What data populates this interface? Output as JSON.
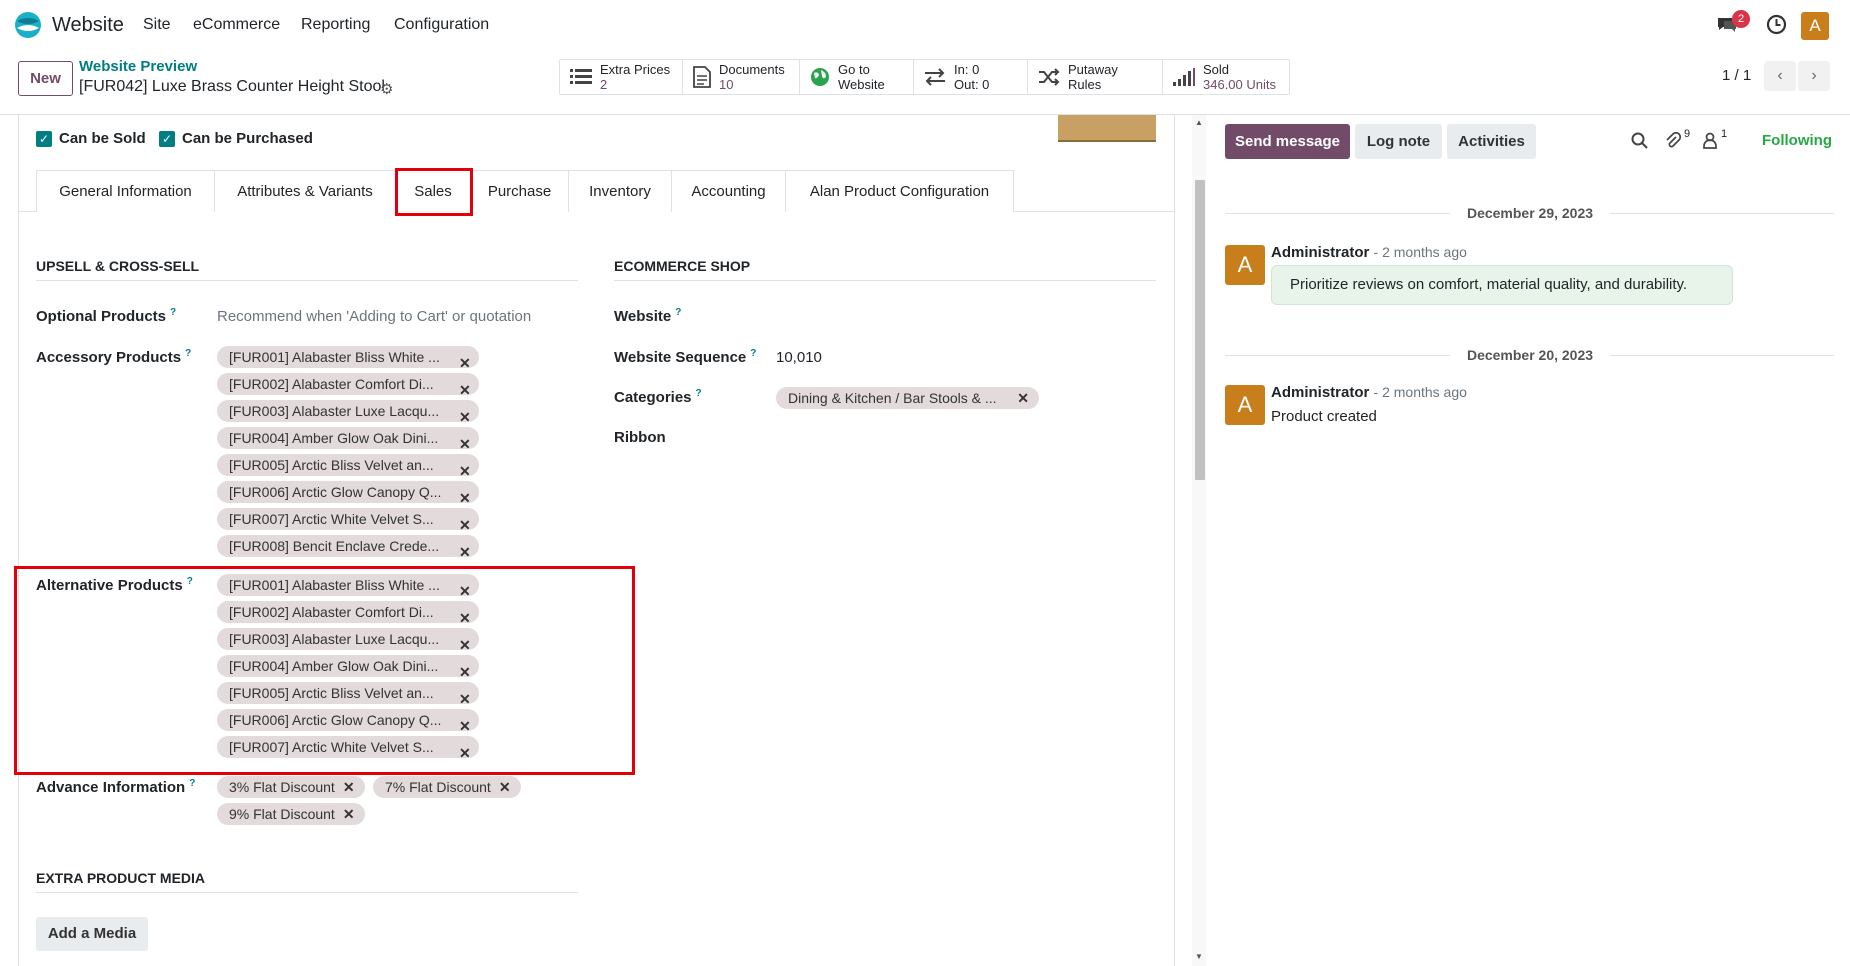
{
  "app": {
    "name": "Website",
    "menu": [
      "Site",
      "eCommerce",
      "Reporting",
      "Configuration"
    ],
    "chat_badge": "2",
    "user_initial": "A"
  },
  "control": {
    "new_label": "New",
    "breadcrumb_parent": "Website Preview",
    "record_title": "[FUR042] Luxe Brass Counter Height Stool",
    "pager": "1 / 1",
    "smart_buttons": [
      {
        "label": "Extra Prices",
        "value": "2",
        "icon": "list-icon"
      },
      {
        "label": "Documents",
        "value": "10",
        "icon": "document-icon"
      },
      {
        "label": "Go to",
        "value": "Website",
        "icon": "globe-icon"
      },
      {
        "label": "In: 0",
        "value": "Out: 0",
        "icon": "transfer-icon"
      },
      {
        "label": "Putaway Rules",
        "value": "",
        "icon": "shuffle-icon"
      },
      {
        "label": "Sold",
        "value": "346.00 Units",
        "icon": "bar-chart-icon"
      }
    ]
  },
  "checkboxes": {
    "can_be_sold": "Can be Sold",
    "can_be_purchased": "Can be Purchased"
  },
  "tabs": [
    "General Information",
    "Attributes & Variants",
    "Sales",
    "Purchase",
    "Inventory",
    "Accounting",
    "Alan Product Configuration"
  ],
  "upsell": {
    "heading": "UPSELL & CROSS-SELL",
    "optional_label": "Optional Products",
    "optional_placeholder": "Recommend when 'Adding to Cart' or quotation",
    "accessory_label": "Accessory Products",
    "accessory_tags": [
      "[FUR001] Alabaster Bliss White ...",
      "[FUR002] Alabaster Comfort Di...",
      "[FUR003] Alabaster Luxe Lacqu...",
      "[FUR004] Amber Glow Oak Dini...",
      "[FUR005] Arctic Bliss Velvet an...",
      "[FUR006] Arctic Glow Canopy Q...",
      "[FUR007] Arctic White Velvet S...",
      "[FUR008] Bencit Enclave Crede..."
    ],
    "alternative_label": "Alternative Products",
    "alternative_tags": [
      "[FUR001] Alabaster Bliss White ...",
      "[FUR002] Alabaster Comfort Di...",
      "[FUR003] Alabaster Luxe Lacqu...",
      "[FUR004] Amber Glow Oak Dini...",
      "[FUR005] Arctic Bliss Velvet an...",
      "[FUR006] Arctic Glow Canopy Q...",
      "[FUR007] Arctic White Velvet S..."
    ],
    "advance_label": "Advance Information",
    "advance_tags": [
      "3% Flat Discount",
      "7% Flat Discount",
      "9% Flat Discount"
    ]
  },
  "ecommerce": {
    "heading": "ECOMMERCE SHOP",
    "website_label": "Website",
    "sequence_label": "Website Sequence",
    "sequence_value": "10,010",
    "categories_label": "Categories",
    "category_tag": "Dining & Kitchen / Bar Stools & ...",
    "ribbon_label": "Ribbon"
  },
  "media": {
    "heading": "EXTRA PRODUCT MEDIA",
    "add_label": "Add a Media"
  },
  "chatter": {
    "send_message": "Send message",
    "log_note": "Log note",
    "activities": "Activities",
    "attachments_count": "9",
    "followers_count": "1",
    "following": "Following",
    "messages": [
      {
        "date": "December 29, 2023",
        "author": "Administrator",
        "time": "- 2 months ago",
        "body": "Prioritize reviews on comfort, material quality, and durability."
      },
      {
        "date": "December 20, 2023",
        "author": "Administrator",
        "time": "- 2 months ago",
        "body": "Product created"
      }
    ]
  },
  "colors": {
    "brand": "#714b67",
    "accent": "#017e84",
    "highlight": "#e3000b",
    "following": "#28a745"
  }
}
